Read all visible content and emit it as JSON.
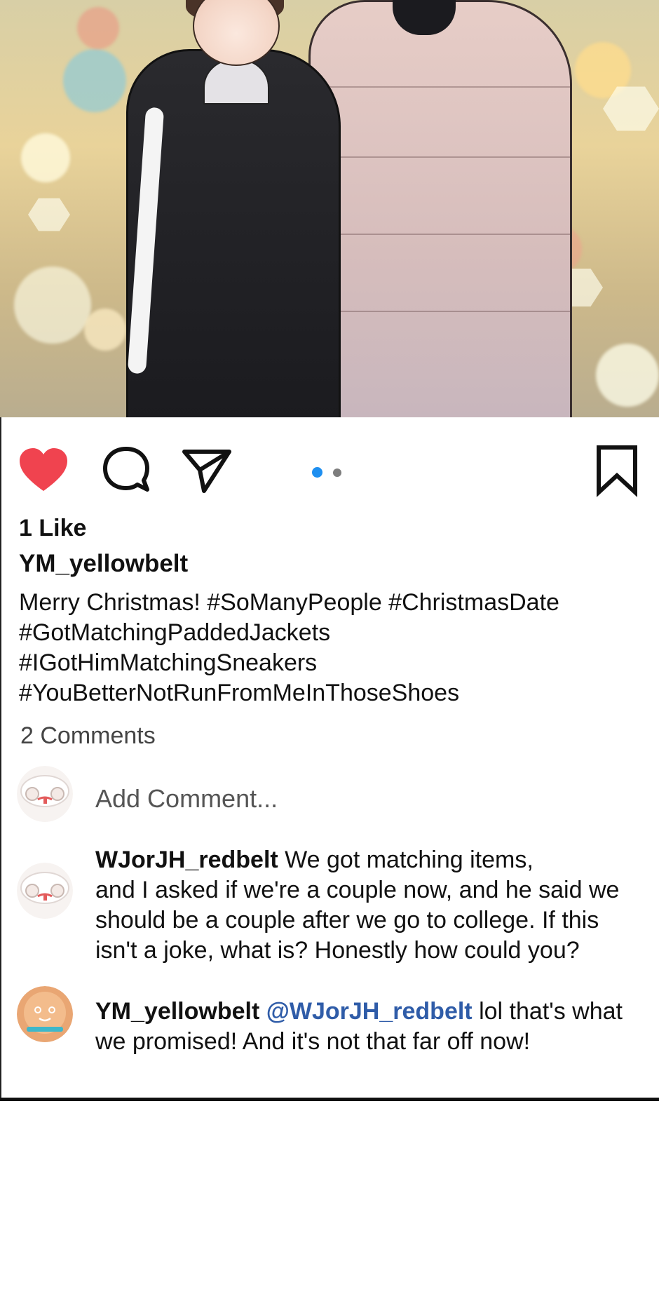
{
  "post": {
    "likes_text": "1 Like",
    "author": "YM_yellowbelt",
    "caption_lines": [
      "Merry Christmas! #SoManyPeople #ChristmasDate",
      "#GotMatchingPaddedJackets",
      "#IGotHimMatchingSneakers",
      "#YouBetterNotRunFromMeInThoseShoes"
    ],
    "comments_count": "2 Comments"
  },
  "actions": {
    "like_icon": "heart-icon",
    "comment_icon": "speech-bubble-icon",
    "share_icon": "send-icon",
    "bookmark_icon": "bookmark-icon",
    "carousel": {
      "total": 2,
      "active": 1
    }
  },
  "add_comment": {
    "placeholder": "Add Comment..."
  },
  "comments": [
    {
      "user": "WJorJH_redbelt",
      "first_line_rest": " We got matching items,",
      "lines": [
        "and I asked if we're a couple now, and he said we",
        "should be a couple after we go to college. If this",
        "isn't a joke, what is? Honestly how could you?"
      ]
    },
    {
      "user": "YM_yellowbelt",
      "mention": "@WJorJH_redbelt",
      "first_line_rest": " lol that's what",
      "lines": [
        "we promised! And it's not that far off now!"
      ]
    }
  ],
  "colors": {
    "heart": "#f0434f",
    "dot_active": "#1e8ff0",
    "dot_inactive": "#7d7d7d",
    "mention": "#2f5ca8"
  }
}
